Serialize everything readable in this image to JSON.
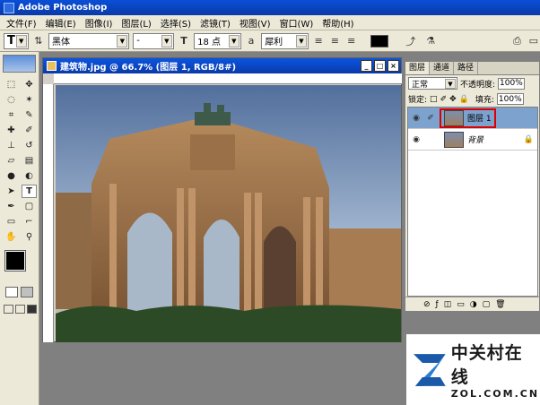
{
  "app_title": "Adobe Photoshop",
  "menu": [
    "文件(F)",
    "编辑(E)",
    "图像(I)",
    "图层(L)",
    "选择(S)",
    "滤镜(T)",
    "视图(V)",
    "窗口(W)",
    "帮助(H)"
  ],
  "options": {
    "tool_glyph": "T",
    "font_family": "黑体",
    "font_style": "-",
    "font_size": "18 点",
    "antialias": "犀利",
    "color": "#000000"
  },
  "document": {
    "title": "建筑物.jpg @ 66.7% (图层 1, RGB/8#)"
  },
  "layers_panel": {
    "tabs": [
      "图层",
      "通道",
      "路径"
    ],
    "blend_mode": "正常",
    "opacity_label": "不透明度:",
    "opacity_value": "100%",
    "lock_label": "锁定:",
    "fill_label": "填充:",
    "fill_value": "100%",
    "layers": [
      {
        "name": "图层 1",
        "selected": true
      },
      {
        "name": "背景",
        "selected": false
      }
    ]
  },
  "watermark": {
    "brand_cn": "中关村在线",
    "brand_en": "ZOL.COM.CN"
  }
}
